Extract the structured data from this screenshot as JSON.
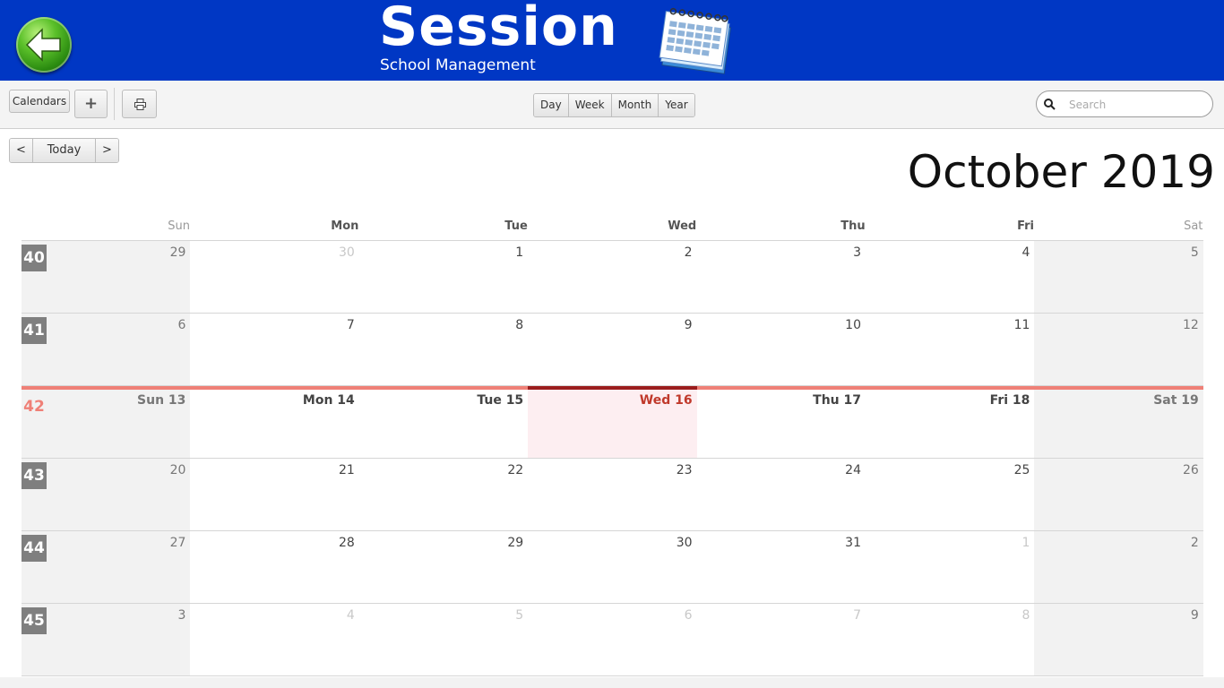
{
  "header": {
    "title": "Session",
    "subtitle": "School Management",
    "brand_color": "#0037c4"
  },
  "toolbar": {
    "calendars_label": "Calendars",
    "add_label": "+",
    "print_icon": "printer-icon",
    "views": [
      "Day",
      "Week",
      "Month",
      "Year"
    ],
    "search_placeholder": "Search"
  },
  "nav": {
    "prev_label": "<",
    "today_label": "Today",
    "next_label": ">"
  },
  "calendar": {
    "month_title": "October 2019",
    "weekdays": [
      "Sun",
      "Mon",
      "Tue",
      "Wed",
      "Thu",
      "Fri",
      "Sat"
    ],
    "current_week": "42",
    "today_color": "#c0392b",
    "weeks": [
      {
        "number": "40",
        "days": [
          {
            "label": "29",
            "other": true
          },
          {
            "label": "30",
            "other": true
          },
          {
            "label": "1"
          },
          {
            "label": "2"
          },
          {
            "label": "3"
          },
          {
            "label": "4"
          },
          {
            "label": "5"
          }
        ]
      },
      {
        "number": "41",
        "days": [
          {
            "label": "6"
          },
          {
            "label": "7"
          },
          {
            "label": "8"
          },
          {
            "label": "9"
          },
          {
            "label": "10"
          },
          {
            "label": "11"
          },
          {
            "label": "12"
          }
        ]
      },
      {
        "number": "42",
        "current": true,
        "days": [
          {
            "label": "Sun 13"
          },
          {
            "label": "Mon 14"
          },
          {
            "label": "Tue 15"
          },
          {
            "label": "Wed 16",
            "today": true
          },
          {
            "label": "Thu 17"
          },
          {
            "label": "Fri 18"
          },
          {
            "label": "Sat 19"
          }
        ]
      },
      {
        "number": "43",
        "days": [
          {
            "label": "20"
          },
          {
            "label": "21"
          },
          {
            "label": "22"
          },
          {
            "label": "23"
          },
          {
            "label": "24"
          },
          {
            "label": "25"
          },
          {
            "label": "26"
          }
        ]
      },
      {
        "number": "44",
        "days": [
          {
            "label": "27"
          },
          {
            "label": "28"
          },
          {
            "label": "29"
          },
          {
            "label": "30"
          },
          {
            "label": "31"
          },
          {
            "label": "1",
            "other": true
          },
          {
            "label": "2",
            "other": true
          }
        ]
      },
      {
        "number": "45",
        "days": [
          {
            "label": "3",
            "other": true
          },
          {
            "label": "4",
            "other": true
          },
          {
            "label": "5",
            "other": true
          },
          {
            "label": "6",
            "other": true
          },
          {
            "label": "7",
            "other": true
          },
          {
            "label": "8",
            "other": true
          },
          {
            "label": "9",
            "other": true
          }
        ]
      }
    ]
  }
}
